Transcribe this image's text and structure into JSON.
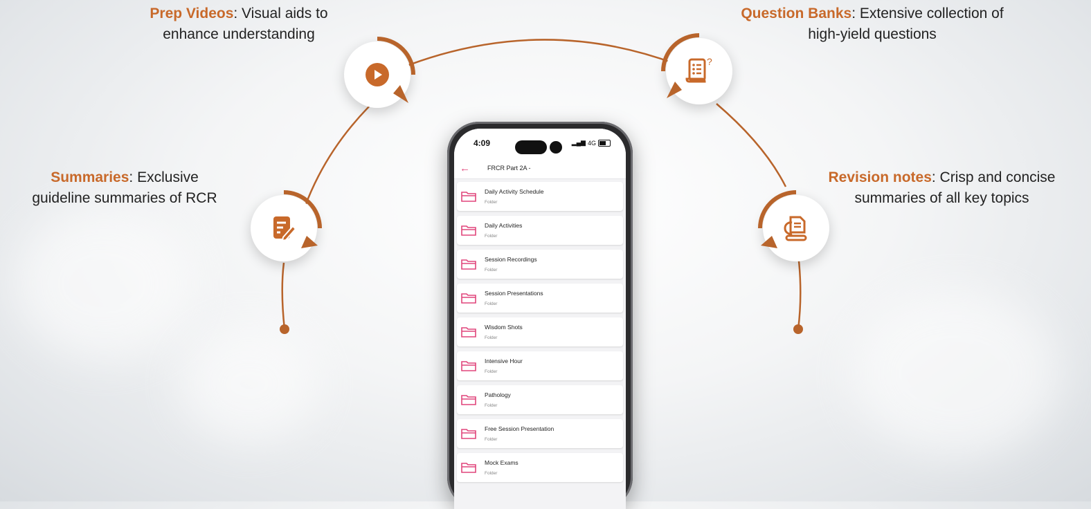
{
  "features": {
    "prep_videos": {
      "title": "Prep Videos",
      "desc_line1": ": Visual aids to",
      "desc_line2": "enhance understanding",
      "icon": "play-icon"
    },
    "question_banks": {
      "title": "Question Banks",
      "desc_line1": ": Extensive collection of",
      "desc_line2": "high-yield questions",
      "icon": "question-scroll-icon"
    },
    "summaries": {
      "title": "Summaries",
      "desc_line1": ": Exclusive",
      "desc_line2": "guideline summaries of RCR",
      "icon": "edit-document-icon"
    },
    "revision_notes": {
      "title": "Revision notes",
      "desc_line1": ": Crisp and concise",
      "desc_line2": "summaries of all key topics",
      "icon": "revision-notes-icon"
    }
  },
  "phone": {
    "time": "4:09",
    "network": "4G",
    "header_title": "FRCR Part 2A -",
    "folders": [
      {
        "name": "Daily Activity Schedule",
        "type": "Folder"
      },
      {
        "name": "Daily Activities",
        "type": "Folder"
      },
      {
        "name": "Session Recordings",
        "type": "Folder"
      },
      {
        "name": "Session Presentations",
        "type": "Folder"
      },
      {
        "name": "Wisdom Shots",
        "type": "Folder"
      },
      {
        "name": "Intensive Hour",
        "type": "Folder"
      },
      {
        "name": "Pathology",
        "type": "Folder"
      },
      {
        "name": "Free Session Presentation",
        "type": "Folder"
      },
      {
        "name": "Mock Exams",
        "type": "Folder"
      }
    ]
  },
  "colors": {
    "accent": "#c8692a",
    "app_accent": "#e0457b"
  }
}
